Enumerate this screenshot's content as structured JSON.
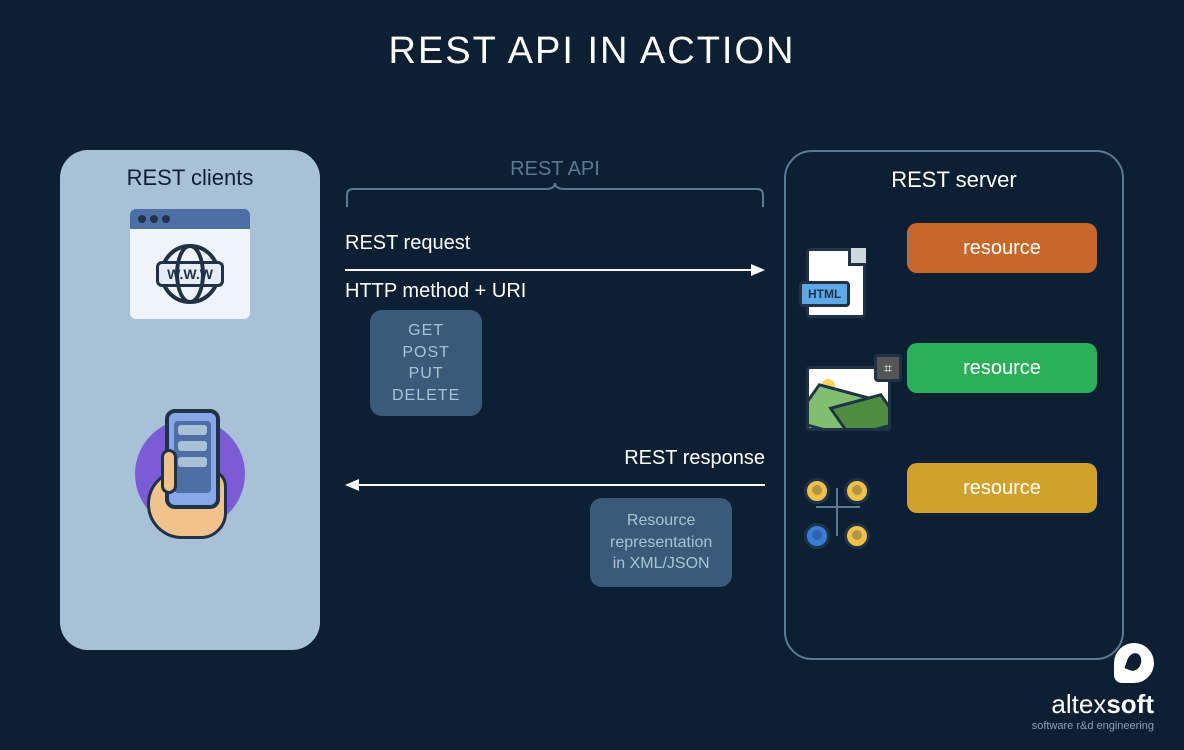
{
  "title": "REST API IN ACTION",
  "clients": {
    "heading": "REST clients",
    "www_label": "W.W.W"
  },
  "api": {
    "label": "REST API"
  },
  "request": {
    "label": "REST request",
    "sublabel": "HTTP method + URI",
    "methods": {
      "get": "GET",
      "post": "POST",
      "put": "PUT",
      "delete": "DELETE"
    }
  },
  "response": {
    "label": "REST response",
    "box_line1": "Resource",
    "box_line2": "representation",
    "box_line3": "in XML/JSON"
  },
  "server": {
    "heading": "REST server",
    "resource_label": "resource",
    "html_tag": "HTML"
  },
  "logo": {
    "brand_light": "altex",
    "brand_bold": "soft",
    "tagline": "software r&d engineering"
  }
}
